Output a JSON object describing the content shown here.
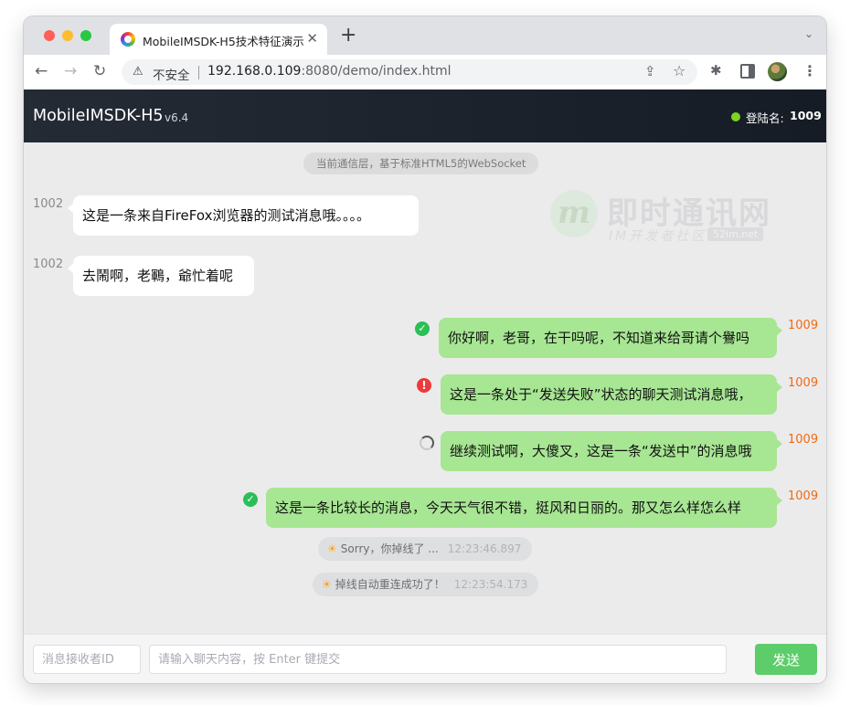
{
  "browser": {
    "tab_title": "MobileIMSDK-H5技术特征演示",
    "tab_close": "✕",
    "new_tab": "+",
    "tab_menu": "⌄",
    "insecure_label": "不安全",
    "url_host": "192.168.0.109",
    "url_rest": ":8080/demo/index.html"
  },
  "header": {
    "title": "MobileIMSDK-H5",
    "version": "v6.4",
    "login_label": "登陆名:",
    "login_id": "1009",
    "status_color": "#7ed321"
  },
  "chat": {
    "system_pill": "当前通信层，基于标准HTML5的WebSocket",
    "watermark": {
      "logo": "m",
      "title": "即时通讯网",
      "subtitle": "IM开发者社区",
      "badge": "52im.net"
    },
    "messages": [
      {
        "direction": "in",
        "sender": "1002",
        "text": "这是一条来自FireFox浏览器的测试消息哦。。。。"
      },
      {
        "direction": "in",
        "sender": "1002",
        "text": "去鬧啊，老鶤，爺忙着呢"
      },
      {
        "direction": "out",
        "sender": "1009",
        "status": "sent",
        "status_icon": "check-circle-icon",
        "text": "你好啊，老哥，在干吗呢，不知道来给哥请个鸒吗"
      },
      {
        "direction": "out",
        "sender": "1009",
        "status": "failed",
        "status_icon": "error-circle-icon",
        "text": "这是一条处于“发送失败”状态的聊天测试消息哦，"
      },
      {
        "direction": "out",
        "sender": "1009",
        "status": "sending",
        "status_icon": "spinner-icon",
        "text": "继续测试啊，大傻叉，这是一条“发送中”的消息哦"
      },
      {
        "direction": "out",
        "sender": "1009",
        "status": "sent",
        "status_icon": "check-circle-icon",
        "text": "这是一条比较长的消息，今天天气很不错，挺风和日丽的。那又怎么样㤰么样"
      }
    ],
    "notices": [
      {
        "text": "Sorry，你掉线了 ...",
        "time": "12:23:46.897"
      },
      {
        "text": "掉线自动重连成功了！",
        "time": "12:23:54.173"
      }
    ]
  },
  "footer": {
    "receiver_placeholder": "消息接收者ID",
    "message_placeholder": "请输入聊天内容，按 Enter 键提交",
    "send_label": "发送",
    "send_color": "#5dcc6a"
  },
  "colors": {
    "outgoing_bubble": "#a7e693",
    "incoming_bubble": "#ffffff",
    "sender_out": "#f06a14",
    "header_bg": "#1b212b"
  }
}
